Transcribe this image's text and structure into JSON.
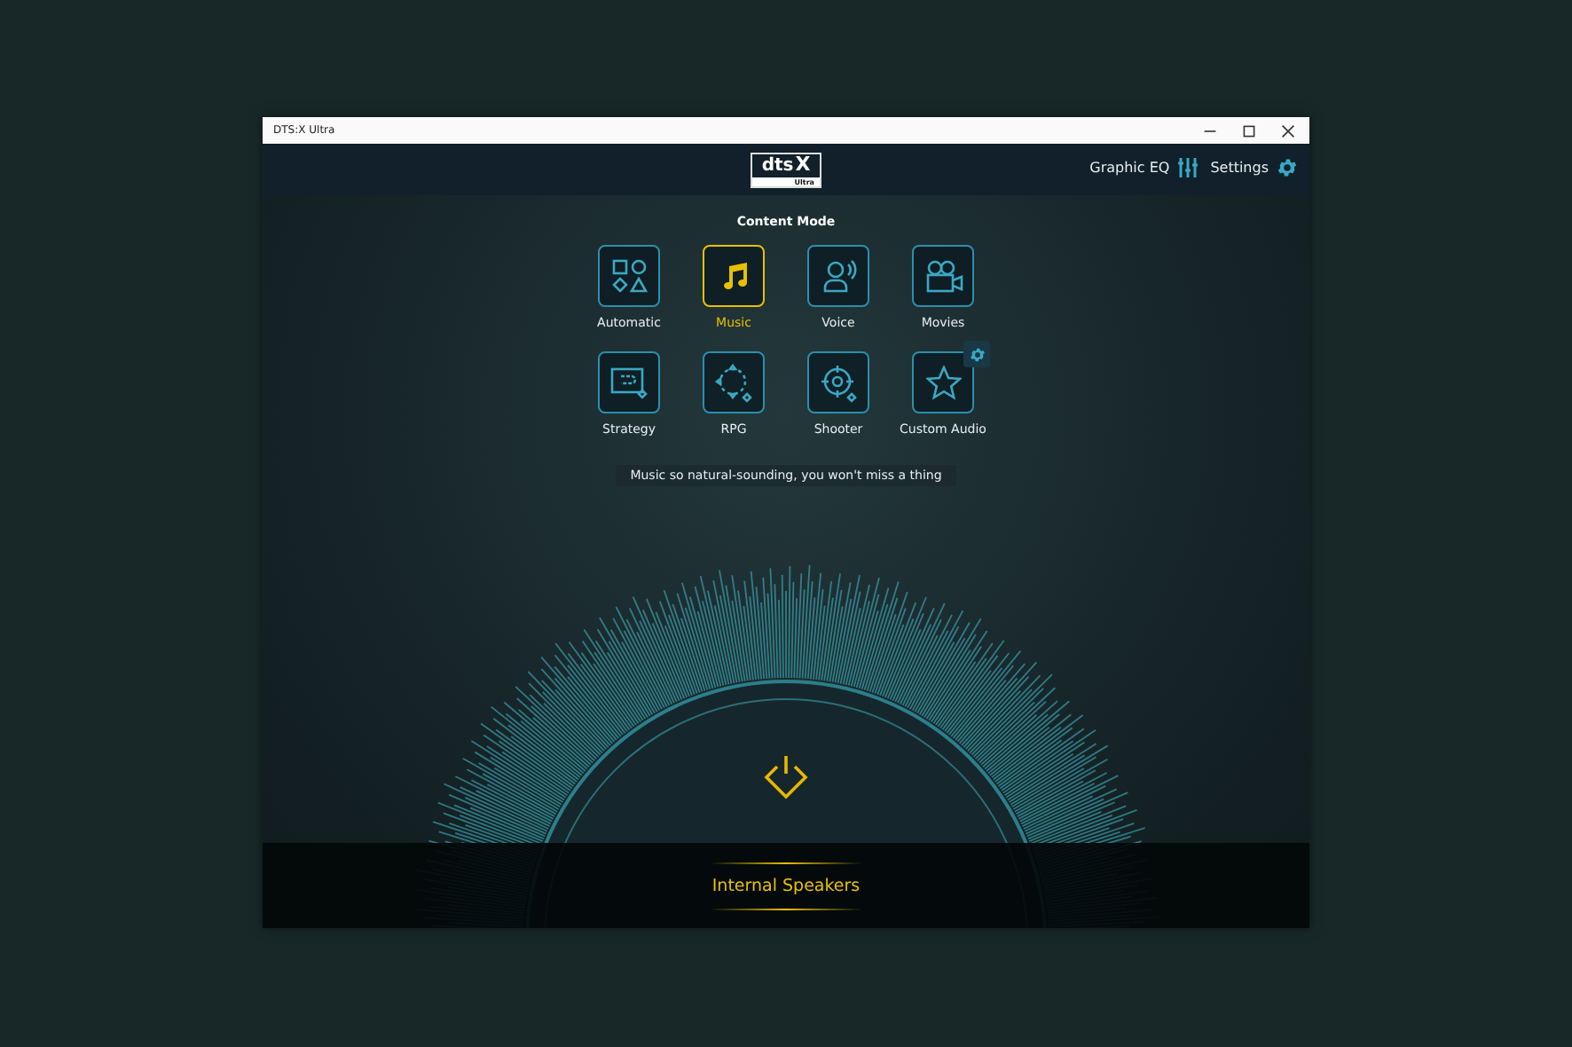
{
  "window": {
    "title": "DTS:X Ultra"
  },
  "logo": {
    "brand": "dts",
    "mark": "X",
    "edition": "Ultra"
  },
  "header_links": [
    {
      "label": "Graphic EQ",
      "kind": "eq"
    },
    {
      "label": "Settings",
      "kind": "settings"
    }
  ],
  "content_mode": {
    "title": "Content Mode",
    "modes": [
      {
        "label": "Automatic",
        "kind": "shapes",
        "selected": false
      },
      {
        "label": "Music",
        "kind": "music",
        "selected": true
      },
      {
        "label": "Voice",
        "kind": "voice",
        "selected": false
      },
      {
        "label": "Movies",
        "kind": "movies",
        "selected": false
      },
      {
        "label": "Strategy",
        "kind": "strategy",
        "selected": false
      },
      {
        "label": "RPG",
        "kind": "rpg",
        "selected": false
      },
      {
        "label": "Shooter",
        "kind": "shooter",
        "selected": false
      },
      {
        "label": "Custom Audio",
        "kind": "custom",
        "selected": false,
        "has_settings": true
      }
    ],
    "description": "Music so natural-sounding, you won't miss a thing"
  },
  "device": {
    "name": "Internal Speakers"
  }
}
